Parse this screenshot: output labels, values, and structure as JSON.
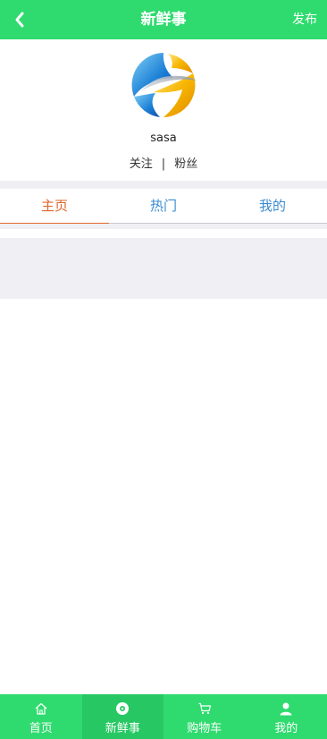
{
  "header": {
    "title": "新鲜事",
    "publish_label": "发布"
  },
  "profile": {
    "username": "sasa",
    "follow_label": "关注",
    "separator": "|",
    "fans_label": "粉丝"
  },
  "tabs": [
    {
      "label": "主页",
      "active": true
    },
    {
      "label": "热门",
      "active": false
    },
    {
      "label": "我的",
      "active": false
    }
  ],
  "bottom_nav": [
    {
      "label": "首页",
      "icon": "home-icon",
      "active": false
    },
    {
      "label": "新鲜事",
      "icon": "fresh-icon",
      "active": true
    },
    {
      "label": "购物车",
      "icon": "cart-icon",
      "active": false
    },
    {
      "label": "我的",
      "icon": "user-icon",
      "active": false
    }
  ],
  "colors": {
    "accent": "#2fdb6f",
    "accent_active": "#27c863",
    "tab_active": "#e0662a",
    "tab_inactive": "#3a8bd0",
    "background_gray": "#efeff4"
  }
}
